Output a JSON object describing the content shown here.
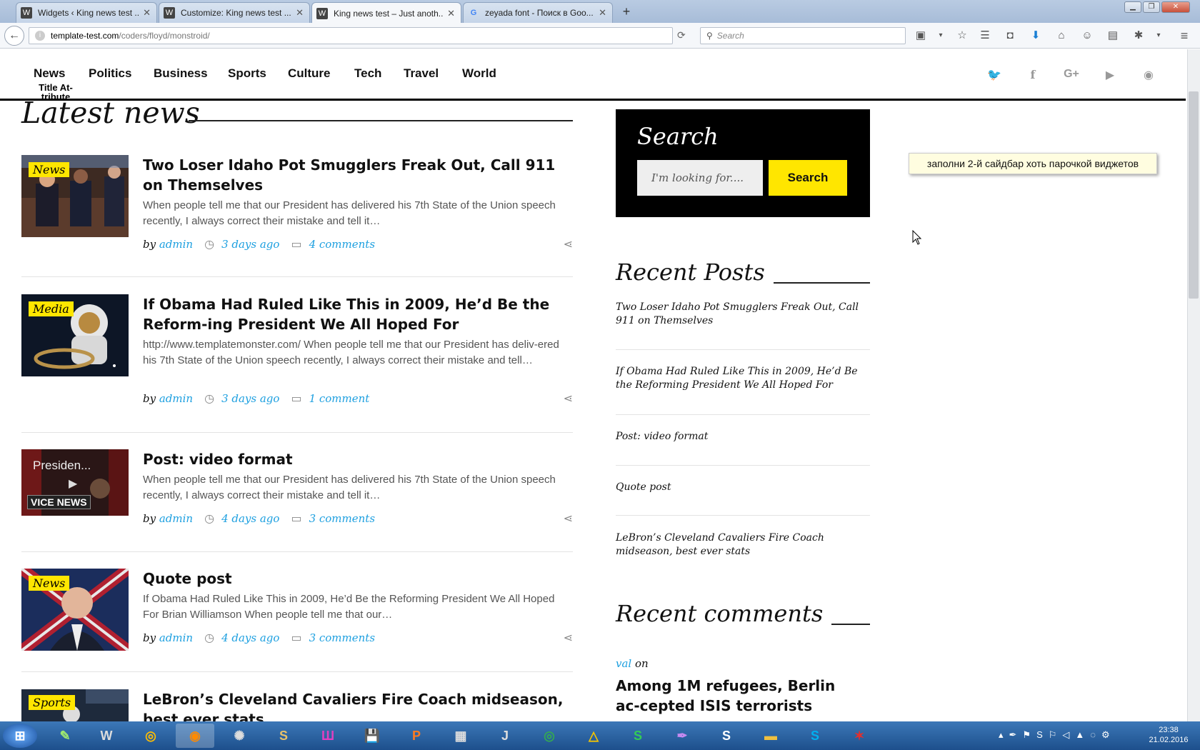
{
  "browser": {
    "tabs": [
      {
        "title": "Widgets ‹ King news test ...",
        "icon": "wordpress-icon"
      },
      {
        "title": "Customize: King news test ...",
        "icon": "wordpress-icon"
      },
      {
        "title": "King news test – Just anoth...",
        "icon": "wordpress-icon",
        "active": true
      },
      {
        "title": "zeyada font - Поиск в Goo...",
        "icon": "google-icon"
      }
    ],
    "url_host": "template-test.com",
    "url_path": "/coders/floyd/monstroid/",
    "search_placeholder": "Search"
  },
  "site": {
    "nav": [
      "News",
      "Politics",
      "Business",
      "Sports",
      "Culture",
      "Tech",
      "Travel",
      "World"
    ],
    "nav_tooltip": "Title At-tribute",
    "social_icons": [
      "twitter-icon",
      "facebook-icon",
      "google-plus-icon",
      "youtube-icon",
      "rss-icon"
    ],
    "latest_heading": "Latest news",
    "posts": [
      {
        "badge": "News",
        "title": "Two Loser Idaho Pot Smugglers Freak Out, Call 911 on Themselves",
        "excerpt": "When people tell me that our President has delivered his 7th State of the Union speech recently, I always correct their mistake and tell it…",
        "by": "by",
        "author": "admin",
        "date": "3 days ago",
        "comments": "4 comments"
      },
      {
        "badge": "Media",
        "title": "If Obama Had Ruled Like This in 2009, He’d Be the Reform-ing President We All Hoped For",
        "excerpt": "http://www.templatemonster.com/ When people tell me that our President has deliv-ered his 7th State of the Union speech recently, I always correct their mistake and tell…",
        "by": "by",
        "author": "admin",
        "date": "3 days ago",
        "comments": "1 comment"
      },
      {
        "video_title": "Presiden...",
        "video_brand": "VICE NEWS",
        "title": "Post: video format",
        "excerpt": "When people tell me that our President has delivered his 7th State of the Union speech recently, I always correct their mistake and tell it…",
        "by": "by",
        "author": "admin",
        "date": "4 days ago",
        "comments": "3 comments"
      },
      {
        "badge": "News",
        "title": "Quote post",
        "excerpt": "If Obama Had Ruled Like This in 2009, He’d Be the Reforming President We All Hoped For Brian Williamson When people tell me that our…",
        "by": "by",
        "author": "admin",
        "date": "4 days ago",
        "comments": "3 comments"
      },
      {
        "badge": "Sports",
        "title": "LeBron’s Cleveland Cavaliers Fire Coach midseason, best ever stats"
      }
    ],
    "sidebar": {
      "search_title": "Search",
      "search_placeholder": "I'm looking for....",
      "search_button": "Search",
      "recent_posts_title": "Recent Posts",
      "recent_posts": [
        "Two Loser Idaho Pot Smugglers Freak Out, Call 911 on Themselves",
        "If Obama Had Ruled Like This in 2009, He’d Be the Reforming President We All Hoped For",
        "Post: video format",
        "Quote post",
        "LeBron’s Cleveland Cavaliers Fire Coach midseason, best ever stats"
      ],
      "recent_comments_title": "Recent comments",
      "comment_author": "val",
      "comment_on": "on",
      "comment_post": "Among 1M refugees, Berlin ac-cepted ISIS terrorists"
    },
    "note": "заполни 2-й сайдбар хоть парочкой виджетов"
  },
  "taskbar": {
    "time": "23:38",
    "date": "21.02.2016"
  },
  "colors": {
    "accent_yellow": "#ffe600",
    "link_blue": "#1ea0e0"
  }
}
